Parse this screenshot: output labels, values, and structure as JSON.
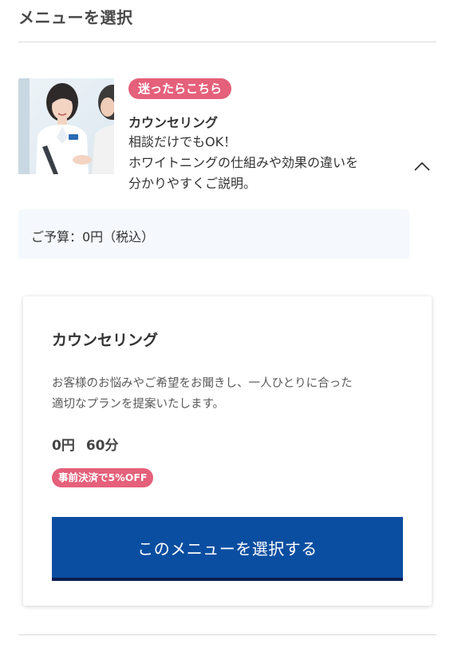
{
  "section": {
    "title": "メニューを選択"
  },
  "menu_item": {
    "badge": "迷ったらこちら",
    "name": "カウンセリング",
    "description_lines": [
      "相談だけでもOK！",
      "ホワイトニングの仕組みや効果の違いを",
      "分かりやすくご説明。"
    ],
    "thumbnail_icon": "counseling-photo",
    "expand_icon": "chevron-up-icon"
  },
  "budget": {
    "text": "ご予算：0円（税込）"
  },
  "card": {
    "title": "カウンセリング",
    "description_lines": [
      "お客様のお悩みやご希望をお聞きし、一人ひとりに合った",
      "適切なプランを提案いたします。"
    ],
    "price": "0円",
    "duration": "60分",
    "discount_badge": "事前決済で5%OFF",
    "select_button": "このメニューを選択する"
  },
  "colors": {
    "badge": "#e5607a",
    "button": "#0a4ea1",
    "button_border": "#0a1f52",
    "budget_bg": "#f5f9fd"
  }
}
